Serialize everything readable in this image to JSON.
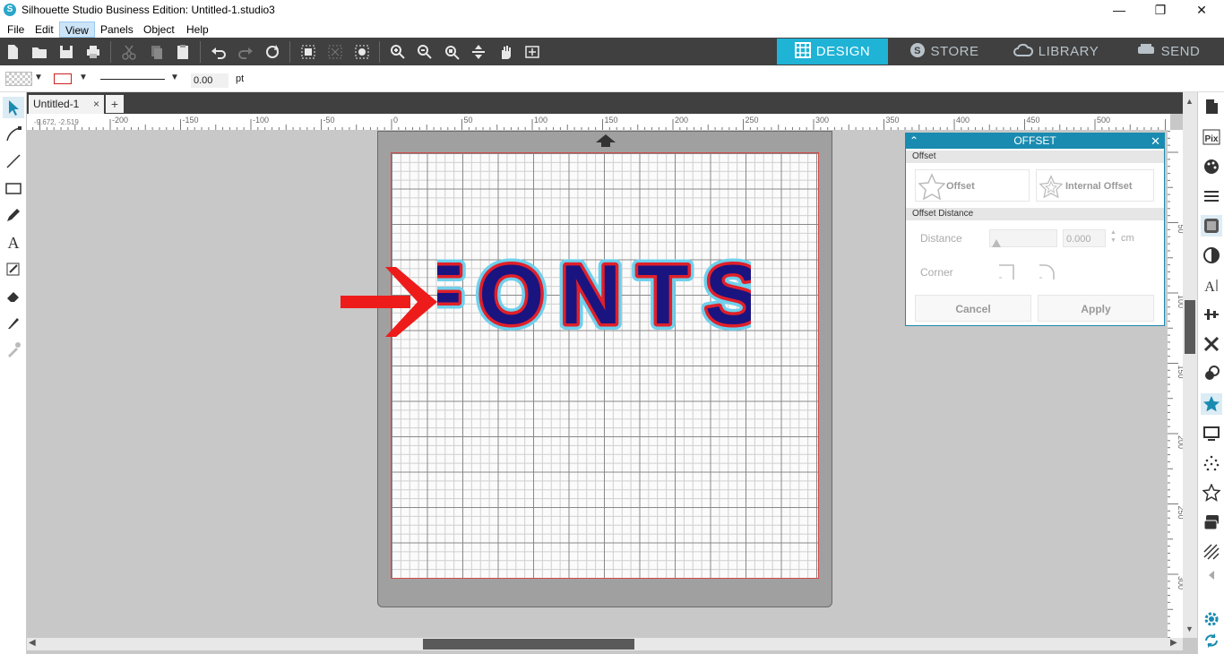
{
  "window": {
    "title": "Silhouette Studio Business Edition: Untitled-1.studio3"
  },
  "menu": [
    {
      "label": "File",
      "active": false
    },
    {
      "label": "Edit",
      "active": false
    },
    {
      "label": "View",
      "active": true
    },
    {
      "label": "Panels",
      "active": false
    },
    {
      "label": "Object",
      "active": false
    },
    {
      "label": "Help",
      "active": false
    }
  ],
  "tabs": {
    "design": "DESIGN",
    "store": "STORE",
    "library": "LIBRARY",
    "send": "SEND"
  },
  "props": {
    "line_width": "0.00",
    "line_unit": "pt"
  },
  "document": {
    "tab_label": "Untitled-1",
    "close": "×",
    "add": "+"
  },
  "ruler": {
    "h_labels": [
      "-200",
      "-150",
      "-100",
      "-50",
      "0",
      "50",
      "100",
      "150",
      "200",
      "250",
      "300",
      "350",
      "400",
      "450",
      "500"
    ],
    "v_labels": [
      "50",
      "100",
      "150",
      "200",
      "250",
      "300"
    ],
    "coords": "-9.672, -2.519"
  },
  "canvas": {
    "text": "FONTS",
    "colors": {
      "fill": "#1a1480",
      "inner_outline": "#e0202a",
      "offset": "#6fd0ec"
    }
  },
  "offset_panel": {
    "title": "OFFSET",
    "section_offset": "Offset",
    "offset_label": "Offset",
    "internal_offset_label": "Internal Offset",
    "section_distance": "Offset Distance",
    "distance_label": "Distance",
    "distance_value": "0.000",
    "distance_unit": "cm",
    "corner_label": "Corner",
    "cancel": "Cancel",
    "apply": "Apply"
  },
  "colors": {
    "accent": "#1fb3d6",
    "toolbar_bg": "#404040",
    "panel_header": "#1a8bb0",
    "arrow": "#ee1b1b"
  }
}
